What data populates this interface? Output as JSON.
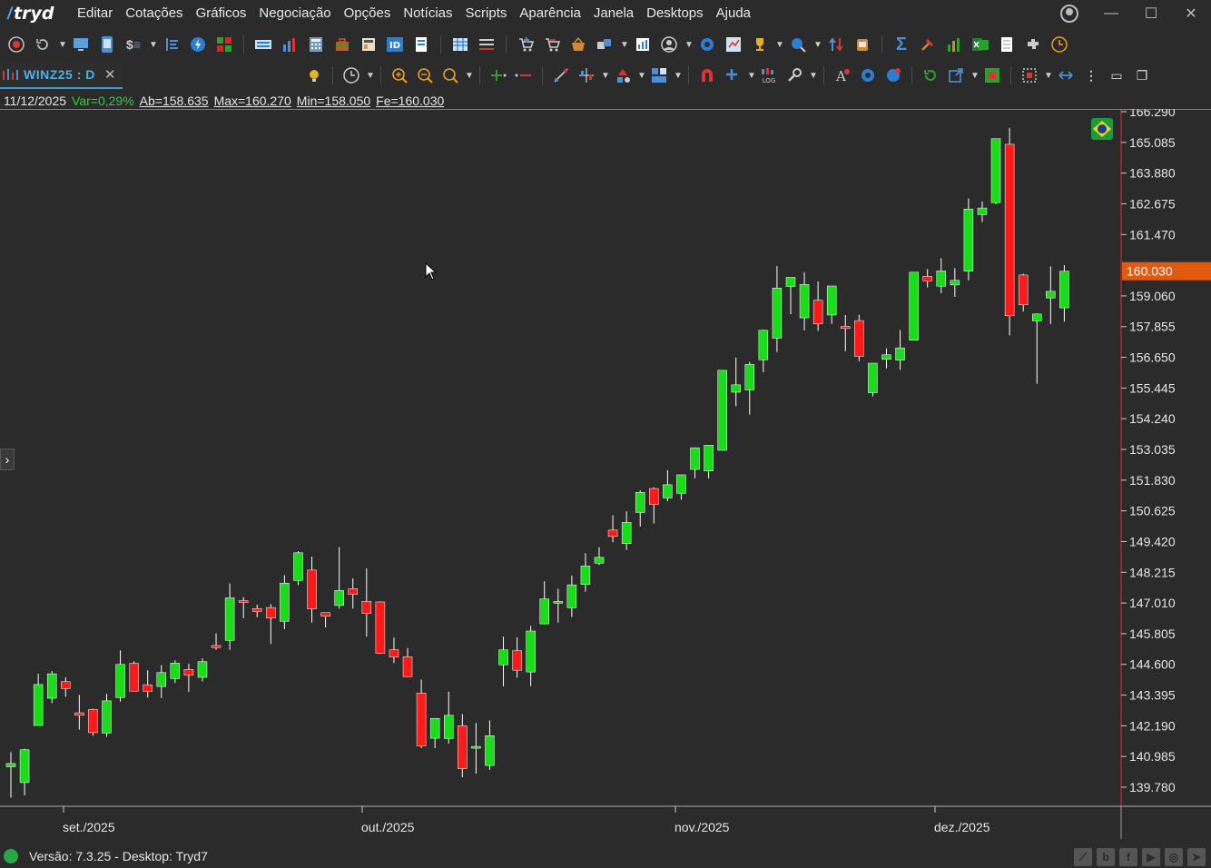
{
  "app": {
    "logo_text": "tryd",
    "menu": [
      "Editar",
      "Cotações",
      "Gráficos",
      "Negociação",
      "Opções",
      "Notícias",
      "Scripts",
      "Aparência",
      "Janela",
      "Desktops",
      "Ajuda"
    ]
  },
  "tab": {
    "title": "WINZ25 : D"
  },
  "info": {
    "date": "11/12/2025",
    "var": "Var=0,29%",
    "ab": "Ab=158.635",
    "max": "Max=160.270",
    "min": "Min=158.050",
    "fe": "Fe=160.030"
  },
  "status": {
    "text": "Versão: 7.3.25 - Desktop: Tryd7"
  },
  "colors": {
    "up": "#19dd19",
    "down": "#ff1a1a",
    "bg": "#2b2b2b",
    "price_tag": "#e25a10",
    "axis_line": "#c03030"
  },
  "chart_data": {
    "type": "candlestick",
    "symbol": "WINZ25",
    "period": "D",
    "current_price_label": "160.030",
    "y_ticks": [
      "166.290",
      "165.085",
      "163.880",
      "162.675",
      "161.470",
      "159.060",
      "157.855",
      "156.650",
      "155.445",
      "154.240",
      "153.035",
      "151.830",
      "150.625",
      "149.420",
      "148.215",
      "147.010",
      "145.805",
      "144.600",
      "143.395",
      "142.190",
      "140.985",
      "139.780"
    ],
    "x_labels": [
      "set./2025",
      "out./2025",
      "nov./2025",
      "dez./2025"
    ],
    "ylim": [
      139.0,
      166.29
    ],
    "candles": [
      {
        "o": 140.58,
        "h": 141.16,
        "l": 139.37,
        "c": 140.71
      },
      {
        "o": 139.96,
        "h": 141.29,
        "l": 139.46,
        "c": 141.25
      },
      {
        "o": 142.2,
        "h": 144.23,
        "l": 142.2,
        "c": 143.81
      },
      {
        "o": 143.27,
        "h": 144.34,
        "l": 143.08,
        "c": 144.23
      },
      {
        "o": 143.92,
        "h": 144.09,
        "l": 143.33,
        "c": 143.65
      },
      {
        "o": 142.7,
        "h": 143.4,
        "l": 142.04,
        "c": 142.6
      },
      {
        "o": 142.83,
        "h": 142.86,
        "l": 141.8,
        "c": 141.92
      },
      {
        "o": 141.9,
        "h": 143.44,
        "l": 141.76,
        "c": 143.17
      },
      {
        "o": 143.3,
        "h": 145.15,
        "l": 143.14,
        "c": 144.6
      },
      {
        "o": 144.64,
        "h": 144.72,
        "l": 143.65,
        "c": 143.55
      },
      {
        "o": 143.8,
        "h": 144.37,
        "l": 143.3,
        "c": 143.54
      },
      {
        "o": 143.73,
        "h": 144.57,
        "l": 143.28,
        "c": 144.28
      },
      {
        "o": 144.04,
        "h": 144.76,
        "l": 143.87,
        "c": 144.65
      },
      {
        "o": 144.4,
        "h": 144.62,
        "l": 143.52,
        "c": 144.18
      },
      {
        "o": 144.09,
        "h": 144.84,
        "l": 143.93,
        "c": 144.71
      },
      {
        "o": 145.34,
        "h": 145.82,
        "l": 145.17,
        "c": 145.26
      },
      {
        "o": 145.54,
        "h": 147.78,
        "l": 145.17,
        "c": 147.21
      },
      {
        "o": 147.1,
        "h": 147.24,
        "l": 146.41,
        "c": 147.06
      },
      {
        "o": 146.79,
        "h": 146.94,
        "l": 146.45,
        "c": 146.68
      },
      {
        "o": 146.83,
        "h": 146.96,
        "l": 145.4,
        "c": 146.42
      },
      {
        "o": 146.29,
        "h": 148.1,
        "l": 145.98,
        "c": 147.79
      },
      {
        "o": 147.89,
        "h": 149.04,
        "l": 147.71,
        "c": 148.98
      },
      {
        "o": 148.3,
        "h": 148.83,
        "l": 146.24,
        "c": 146.78
      },
      {
        "o": 146.63,
        "h": 146.51,
        "l": 146.05,
        "c": 146.49
      },
      {
        "o": 146.91,
        "h": 149.2,
        "l": 146.79,
        "c": 147.5
      },
      {
        "o": 147.57,
        "h": 147.98,
        "l": 146.79,
        "c": 147.35
      },
      {
        "o": 147.07,
        "h": 148.37,
        "l": 145.69,
        "c": 146.6
      },
      {
        "o": 147.05,
        "h": 147.07,
        "l": 145.01,
        "c": 145.03
      },
      {
        "o": 145.17,
        "h": 145.65,
        "l": 144.65,
        "c": 144.89
      },
      {
        "o": 144.9,
        "h": 145.24,
        "l": 144.29,
        "c": 144.12
      },
      {
        "o": 143.47,
        "h": 144.0,
        "l": 141.32,
        "c": 141.4
      },
      {
        "o": 141.7,
        "h": 142.26,
        "l": 141.31,
        "c": 142.48
      },
      {
        "o": 141.69,
        "h": 143.53,
        "l": 141.49,
        "c": 142.6
      },
      {
        "o": 142.19,
        "h": 142.65,
        "l": 140.17,
        "c": 140.51
      },
      {
        "o": 141.38,
        "h": 142.3,
        "l": 140.31,
        "c": 141.38
      },
      {
        "o": 140.63,
        "h": 142.4,
        "l": 140.46,
        "c": 141.8
      },
      {
        "o": 144.58,
        "h": 145.69,
        "l": 143.74,
        "c": 145.17
      },
      {
        "o": 145.14,
        "h": 145.66,
        "l": 144.08,
        "c": 144.37
      },
      {
        "o": 144.3,
        "h": 146.11,
        "l": 143.75,
        "c": 145.91
      },
      {
        "o": 146.19,
        "h": 147.86,
        "l": 146.17,
        "c": 147.17
      },
      {
        "o": 147.07,
        "h": 147.57,
        "l": 146.24,
        "c": 147.07
      },
      {
        "o": 146.82,
        "h": 148.08,
        "l": 146.46,
        "c": 147.72
      },
      {
        "o": 147.74,
        "h": 148.97,
        "l": 147.45,
        "c": 148.46
      },
      {
        "o": 148.57,
        "h": 149.2,
        "l": 148.5,
        "c": 148.8
      },
      {
        "o": 149.87,
        "h": 150.45,
        "l": 149.39,
        "c": 149.62
      },
      {
        "o": 149.34,
        "h": 150.61,
        "l": 149.09,
        "c": 150.17
      },
      {
        "o": 150.56,
        "h": 151.43,
        "l": 150.01,
        "c": 151.35
      },
      {
        "o": 151.5,
        "h": 151.55,
        "l": 150.13,
        "c": 150.88
      },
      {
        "o": 151.13,
        "h": 152.22,
        "l": 151.0,
        "c": 151.65
      },
      {
        "o": 151.31,
        "h": 151.7,
        "l": 151.06,
        "c": 152.04
      },
      {
        "o": 152.25,
        "h": 153.11,
        "l": 151.9,
        "c": 153.1
      },
      {
        "o": 152.19,
        "h": 153.2,
        "l": 151.9,
        "c": 153.2
      },
      {
        "o": 153.0,
        "h": 156.14,
        "l": 153.0,
        "c": 156.14
      },
      {
        "o": 155.28,
        "h": 156.64,
        "l": 154.73,
        "c": 155.57
      },
      {
        "o": 155.37,
        "h": 156.47,
        "l": 154.4,
        "c": 156.37
      },
      {
        "o": 156.55,
        "h": 157.74,
        "l": 156.06,
        "c": 157.71
      },
      {
        "o": 157.4,
        "h": 160.23,
        "l": 156.86,
        "c": 159.37
      },
      {
        "o": 159.43,
        "h": 159.75,
        "l": 158.34,
        "c": 159.79
      },
      {
        "o": 158.2,
        "h": 159.99,
        "l": 157.71,
        "c": 159.51
      },
      {
        "o": 158.89,
        "h": 159.63,
        "l": 157.69,
        "c": 157.96
      },
      {
        "o": 158.31,
        "h": 159.31,
        "l": 157.96,
        "c": 159.45
      },
      {
        "o": 157.86,
        "h": 158.31,
        "l": 156.89,
        "c": 157.78
      },
      {
        "o": 158.09,
        "h": 158.32,
        "l": 156.5,
        "c": 156.69
      },
      {
        "o": 155.26,
        "h": 155.94,
        "l": 155.12,
        "c": 156.42
      },
      {
        "o": 156.57,
        "h": 157.0,
        "l": 156.22,
        "c": 156.75
      },
      {
        "o": 156.54,
        "h": 157.72,
        "l": 156.16,
        "c": 157.02
      },
      {
        "o": 157.32,
        "h": 160.0,
        "l": 157.31,
        "c": 159.99
      },
      {
        "o": 159.83,
        "h": 160.11,
        "l": 159.39,
        "c": 159.65
      },
      {
        "o": 159.44,
        "h": 160.54,
        "l": 159.17,
        "c": 160.04
      },
      {
        "o": 159.49,
        "h": 160.15,
        "l": 159.02,
        "c": 159.67
      },
      {
        "o": 160.03,
        "h": 162.89,
        "l": 159.67,
        "c": 162.47
      },
      {
        "o": 162.25,
        "h": 162.77,
        "l": 161.96,
        "c": 162.51
      },
      {
        "o": 162.72,
        "h": 165.15,
        "l": 162.66,
        "c": 165.23
      },
      {
        "o": 165.01,
        "h": 165.65,
        "l": 157.51,
        "c": 158.28
      },
      {
        "o": 159.88,
        "h": 159.93,
        "l": 158.45,
        "c": 158.71
      },
      {
        "o": 158.08,
        "h": 158.38,
        "l": 155.61,
        "c": 158.35
      },
      {
        "o": 158.98,
        "h": 160.22,
        "l": 157.96,
        "c": 159.24
      },
      {
        "o": 158.59,
        "h": 160.27,
        "l": 158.05,
        "c": 160.03
      }
    ]
  }
}
